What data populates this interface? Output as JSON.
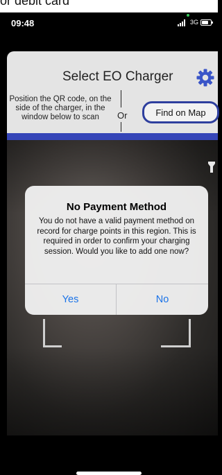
{
  "page_top_text": "or debit card",
  "status_bar": {
    "time": "09:48",
    "network": "3G"
  },
  "header": {
    "title": "Select EO Charger",
    "instructions": "Position the QR code, on the side of the charger, in the window below to scan",
    "or_label": "Or",
    "find_on_map_label": "Find on Map"
  },
  "dialog": {
    "title": "No Payment Method",
    "message": "You do not have a valid payment method on record for charge points in this region. This is required in order to confirm your charging session. Would you like to add one now?",
    "yes_label": "Yes",
    "no_label": "No"
  },
  "colors": {
    "accent_blue": "#3545b8",
    "button_border": "#2e3f9e",
    "gear": "#3a55c8",
    "dialog_button": "#1a73e8"
  },
  "icons": [
    "settings-gear-icon",
    "flashlight-icon",
    "signal-icon",
    "battery-icon"
  ]
}
